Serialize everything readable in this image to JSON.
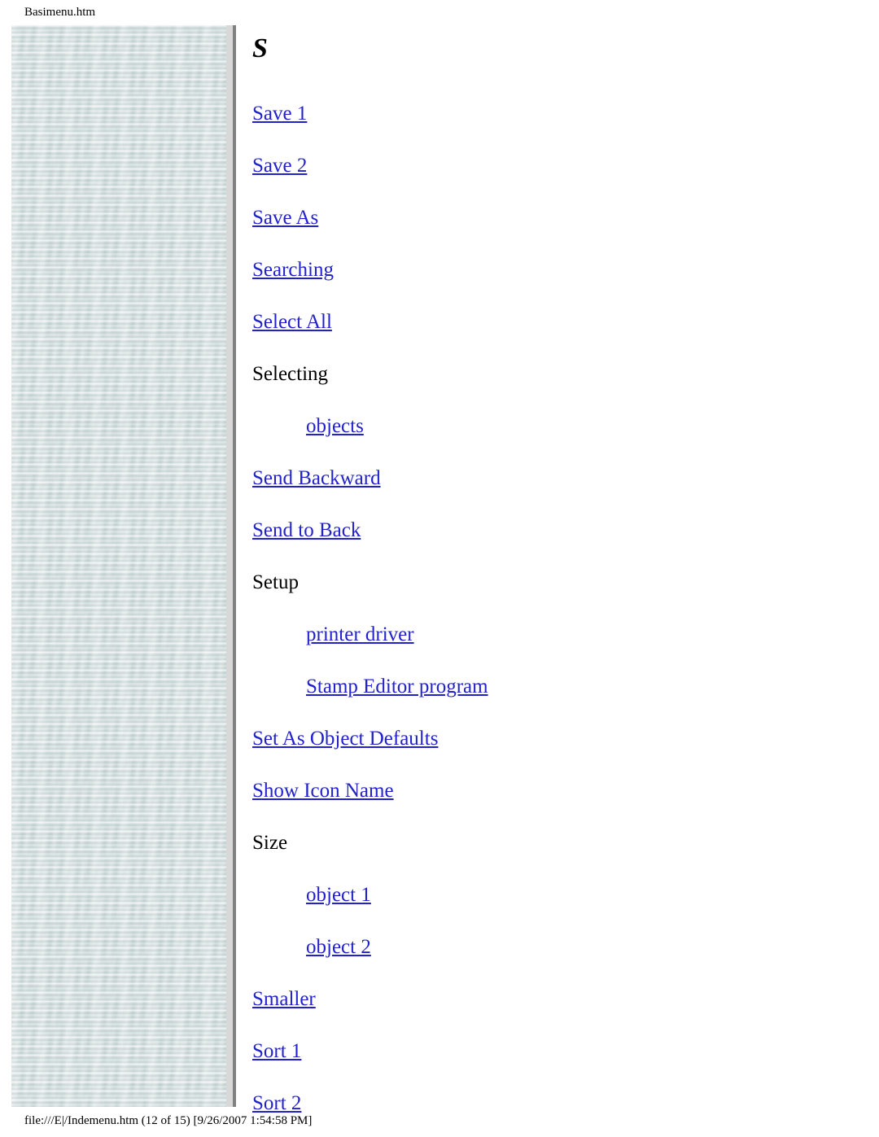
{
  "browser_print": {
    "header_title": "Basimenu.htm",
    "footer_status": "file:///E|/Indemenu.htm (12 of 15) [9/26/2007 1:54:58 PM]"
  },
  "colors": {
    "link": "#2222cc",
    "text": "#000000",
    "page_background": "#ffffff",
    "sidebar_texture": "#ccd9d8",
    "sidebar_edge_light": "#d8d8d8",
    "sidebar_edge_dark": "#808080"
  },
  "sidebar": {
    "name": "decorative-texture-column"
  },
  "index": {
    "letter": "S",
    "entries": [
      {
        "label": "Save 1",
        "type": "link",
        "level": 0
      },
      {
        "label": "Save 2",
        "type": "link",
        "level": 0
      },
      {
        "label": "Save As",
        "type": "link",
        "level": 0
      },
      {
        "label": "Searching",
        "type": "link",
        "level": 0
      },
      {
        "label": "Select All",
        "type": "link",
        "level": 0
      },
      {
        "label": "Selecting",
        "type": "plain",
        "level": 0
      },
      {
        "label": "objects",
        "type": "link",
        "level": 1
      },
      {
        "label": "Send Backward",
        "type": "link",
        "level": 0
      },
      {
        "label": "Send to Back",
        "type": "link",
        "level": 0
      },
      {
        "label": "Setup",
        "type": "plain",
        "level": 0
      },
      {
        "label": "printer driver",
        "type": "link",
        "level": 1
      },
      {
        "label": "Stamp Editor program",
        "type": "link",
        "level": 1
      },
      {
        "label": "Set As Object Defaults",
        "type": "link",
        "level": 0
      },
      {
        "label": "Show Icon Name",
        "type": "link",
        "level": 0
      },
      {
        "label": "Size",
        "type": "plain",
        "level": 0
      },
      {
        "label": "object 1",
        "type": "link",
        "level": 1
      },
      {
        "label": "object 2",
        "type": "link",
        "level": 1
      },
      {
        "label": "Smaller",
        "type": "link",
        "level": 0
      },
      {
        "label": "Sort 1",
        "type": "link",
        "level": 0
      },
      {
        "label": "Sort 2",
        "type": "link",
        "level": 0
      }
    ]
  }
}
